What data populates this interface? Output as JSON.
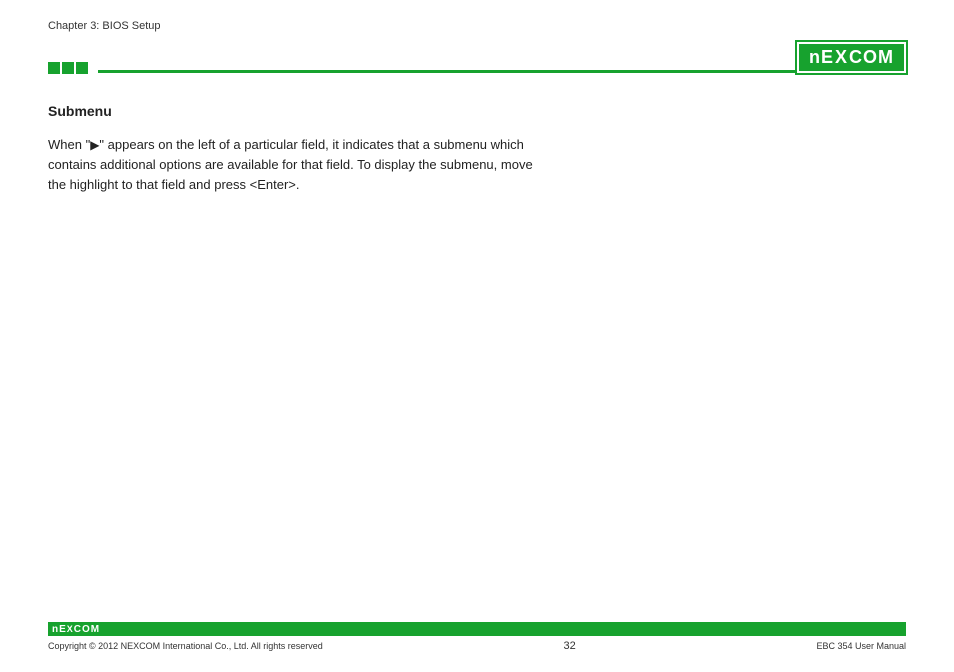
{
  "header": {
    "chapter": "Chapter 3: BIOS Setup",
    "brand": "NEXCOM"
  },
  "content": {
    "section_title": "Submenu",
    "body_prefix": "When \"",
    "body_suffix": "\" appears on the left of a particular field, it indicates that a submenu which contains additional options are available for that field. To display the submenu, move the highlight to that field and press <Enter>."
  },
  "footer": {
    "brand": "NEXCOM",
    "copyright": "Copyright © 2012 NEXCOM International Co., Ltd. All rights reserved",
    "page": "32",
    "manual": "EBC 354 User Manual"
  }
}
